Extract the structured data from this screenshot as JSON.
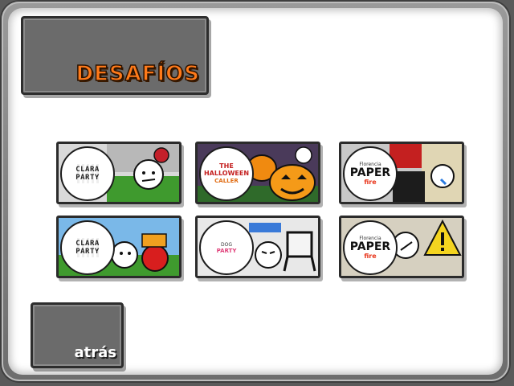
{
  "header": {
    "title": "DESAFÍOS"
  },
  "nav": {
    "back_label": "atrás"
  },
  "cards": [
    {
      "logo_lines": [
        "CLARA",
        "PARTY"
      ]
    },
    {
      "logo_lines": [
        "THE",
        "HALLOWEEN",
        "CALLER"
      ]
    },
    {
      "logo_lines": [
        "Florencia",
        "PAPER",
        "fire"
      ]
    },
    {
      "logo_lines": [
        "CLARA",
        "PARTY"
      ]
    },
    {
      "logo_lines": [
        "DOG",
        "PARTY"
      ]
    },
    {
      "logo_lines": [
        "Florencia",
        "PAPER",
        "fire"
      ]
    }
  ],
  "colors": {
    "title_orange": "#ff7a1a",
    "box_gray": "#6b6b6b",
    "panel_white": "#ffffff"
  }
}
